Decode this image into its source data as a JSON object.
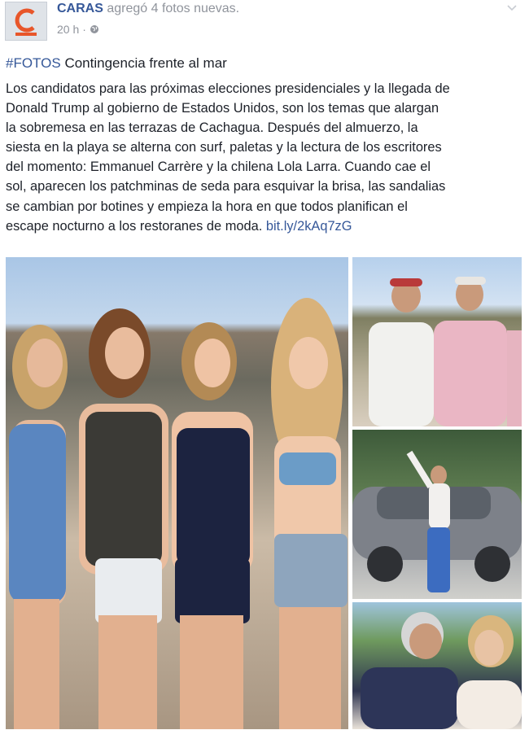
{
  "post": {
    "page_name": "CARAS",
    "action_text": "agregó 4 fotos nuevas.",
    "timestamp": "20 h",
    "meta_separator": "·",
    "hashtag": "#FOTOS",
    "headline_text": "Contingencia frente al mar",
    "body_lines": [
      "Los candidatos para las próximas elecciones presidenciales y la llegada de",
      "Donald Trump al gobierno de Estados Unidos, son los temas que alargan",
      "la sobremesa en las terrazas de Cachagua. Después del almuerzo, la",
      "siesta en la playa se alterna con surf, paletas y la lectura de los escritores",
      "del momento: Emmanuel Carrère y la chilena Lola Larra. Cuando cae el",
      "sol, aparecen los patchminas de seda para esquivar la brisa, las sandalias",
      "se cambian por botines y empieza la hora en que todos planifican el",
      "escape nocturno a los restoranes de moda."
    ],
    "link_text": "bit.ly/2kAq7zG"
  },
  "icons": {
    "avatar": "caras-logo",
    "privacy": "globe-icon",
    "menu": "chevron-down-icon"
  },
  "colors": {
    "link": "#365899",
    "brand_orange": "#e8562a",
    "meta_gray": "#90949c"
  }
}
